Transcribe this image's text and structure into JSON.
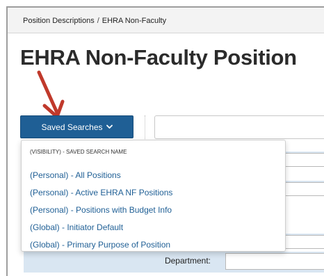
{
  "breadcrumb": {
    "items": [
      "Position Descriptions",
      "EHRA Non-Faculty"
    ],
    "separator": "/"
  },
  "page": {
    "title": "EHRA Non-Faculty Position"
  },
  "toolbar": {
    "saved_searches_label": "Saved Searches",
    "search_value": ""
  },
  "dropdown": {
    "header": "(VISIBILITY) - SAVED SEARCH NAME",
    "items": [
      "(Personal) - All Positions",
      "(Personal) - Active EHRA NF Positions",
      "(Personal) - Positions with Budget Info",
      "(Global) - Initiator Default",
      "(Global) - Primary Purpose of Position"
    ]
  },
  "form": {
    "department_label": "Department:"
  },
  "colors": {
    "accent": "#1f5f95",
    "arrow": "#c0392b",
    "form_row_bg": "#d9e6f2"
  },
  "icons": {
    "button_chevron": "chevron-down-icon",
    "annotation": "annotation-arrow"
  }
}
